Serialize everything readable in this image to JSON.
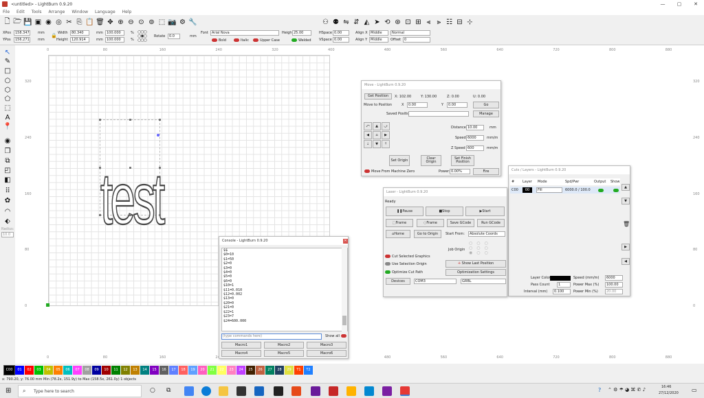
{
  "app": {
    "title": "<untitled> - LightBurn 0.9.20"
  },
  "menu": [
    "File",
    "Edit",
    "Tools",
    "Arrange",
    "Window",
    "Language",
    "Help"
  ],
  "toolbar2": {
    "xpos_label": "XPos",
    "xpos": "158.347",
    "ypos_label": "YPos",
    "ypos": "156.271",
    "unit": "mm",
    "width_label": "Width",
    "width": "80.340",
    "height_label": "Height",
    "height": "120.914",
    "scale_w": "100.000",
    "scale_h": "100.000",
    "pct": "%",
    "rotate_label": "Rotate",
    "rotate": "0.0",
    "font_label": "Font",
    "font": "Arial Nova",
    "font_height_label": "Height",
    "font_height": "25.00",
    "hspace_label": "HSpace",
    "hspace": "0.00",
    "vspace_label": "VSpace",
    "vspace": "0.00",
    "alignx_label": "Align X",
    "alignx": "Middle",
    "aligny_label": "Align Y",
    "aligny": "Middle",
    "mode": "Normal",
    "offset_label": "Offset",
    "offset": "0",
    "bold": "Bold",
    "italic": "Italic",
    "upper": "Upper Case",
    "welded": "Welded"
  },
  "ruler": {
    "top": [
      "0",
      "80",
      "160",
      "240",
      "320",
      "400",
      "480",
      "560",
      "640",
      "720",
      "800",
      "880"
    ],
    "left": [
      "320",
      "240",
      "160",
      "80",
      "0"
    ],
    "right": [
      "320",
      "240",
      "160",
      "80",
      "0"
    ]
  },
  "canvas": {
    "text": "test"
  },
  "left_tools": {
    "radius_label": "Radius:",
    "radius": "10.0"
  },
  "move": {
    "title": "Move - LightBurn 0.9.20",
    "get_position": "Get Position",
    "x": "X: 102.00",
    "y": "Y: 130.00",
    "z": "Z: 0.00",
    "u": "U: 0.00",
    "move_to": "Move to Position",
    "x_label": "X",
    "x_val": "0.00",
    "y_label": "Y",
    "y_val": "0.00",
    "go": "Go",
    "saved_label": "Saved Positions:",
    "manage": "Manage",
    "distance_label": "Distance",
    "distance": "10.00",
    "speed_label": "Speed",
    "speed": "6000",
    "zspeed_label": "Z Speed",
    "zspeed": "600",
    "unit_mm": "mm",
    "unit_mms": "mm/m",
    "set_origin": "Set Origin",
    "clear_origin": "Clear Origin",
    "set_finish": "Set Finish Position",
    "move_from_zero": "Move From Machine Zero",
    "power_label": "Power:",
    "power": "0.00%",
    "fire": "Fire"
  },
  "laser": {
    "title": "Laser - LightBurn 0.9.20",
    "state": "Ready",
    "pause": "Pause",
    "stop": "Stop",
    "start": "Start",
    "frame1": "Frame",
    "frame2": "Frame",
    "save_gcode": "Save GCode",
    "run_gcode": "Run GCode",
    "home": "Home",
    "go_origin": "Go to Origin",
    "start_from_label": "Start From:",
    "start_from": "Absolute Coords",
    "job_origin": "Job Origin",
    "cut_selected": "Cut Selected Graphics",
    "use_selection": "Use Selection Origin",
    "show_last": "Show Last Position",
    "optimize": "Optimize Cut Path",
    "opt_settings": "Optimization Settings",
    "devices": "Devices",
    "port": "COM3",
    "firmware": "GRBL"
  },
  "cuts": {
    "title": "Cuts / Layers - LightBurn 0.9.20",
    "headers": [
      "#",
      "Layer",
      "Mode",
      "Spd/Pwr",
      "Output",
      "Show"
    ],
    "row": {
      "num": "C00",
      "layer": "00",
      "mode": "Fill",
      "spdpwr": "6000.0 / 100.0"
    },
    "layer_color": "Layer Color",
    "speed_label": "Speed (mm/m)",
    "speed": "6000",
    "passes_label": "Pass Count",
    "passes": "1",
    "pmax_label": "Power Max (%)",
    "pmax": "100.00",
    "interval_label": "Interval (mm)",
    "interval": "0.100",
    "pmin_label": "Power Min (%)",
    "pmin": "20.00"
  },
  "console": {
    "title": "Console - LightBurn 0.9.20",
    "lines": [
      "$$",
      "$0=10",
      "$1=50",
      "$2=0",
      "$3=0",
      "$4=0",
      "$5=0",
      "$6=0",
      "$10=1",
      "$11=0.010",
      "$12=0.002",
      "$13=0",
      "$20=0",
      "$21=0",
      "$22=1",
      "$23=7",
      "$24=600.000"
    ],
    "placeholder": "(type commands here)",
    "show_all": "Show all",
    "macros": [
      "Macro1",
      "Macro2",
      "Macro3",
      "Macro4",
      "Macro5",
      "Macro6"
    ]
  },
  "palette": [
    {
      "label": "C00",
      "color": "#000000"
    },
    {
      "label": "01",
      "color": "#0000ff"
    },
    {
      "label": "02",
      "color": "#ff0000"
    },
    {
      "label": "03",
      "color": "#00c000"
    },
    {
      "label": "04",
      "color": "#c0c000"
    },
    {
      "label": "05",
      "color": "#ff8000"
    },
    {
      "label": "06",
      "color": "#00c0c0"
    },
    {
      "label": "07",
      "color": "#ff40ff"
    },
    {
      "label": "08",
      "color": "#a0a0a0"
    },
    {
      "label": "09",
      "color": "#0000a0"
    },
    {
      "label": "10",
      "color": "#a00000"
    },
    {
      "label": "11",
      "color": "#008000"
    },
    {
      "label": "12",
      "color": "#808000"
    },
    {
      "label": "13",
      "color": "#c08000"
    },
    {
      "label": "14",
      "color": "#008080"
    },
    {
      "label": "15",
      "color": "#8000c0"
    },
    {
      "label": "16",
      "color": "#606060"
    },
    {
      "label": "17",
      "color": "#6080ff"
    },
    {
      "label": "18",
      "color": "#ff6060"
    },
    {
      "label": "19",
      "color": "#60a0ff"
    },
    {
      "label": "20",
      "color": "#ff60c0"
    },
    {
      "label": "21",
      "color": "#80ff40"
    },
    {
      "label": "22",
      "color": "#ffff60"
    },
    {
      "label": "23",
      "color": "#ff80c0"
    },
    {
      "label": "24",
      "color": "#c040ff"
    },
    {
      "label": "25",
      "color": "#402000"
    },
    {
      "label": "26",
      "color": "#c06040"
    },
    {
      "label": "27",
      "color": "#008060"
    },
    {
      "label": "28",
      "color": "#204060"
    },
    {
      "label": "29",
      "color": "#e0e040"
    },
    {
      "label": "T1",
      "color": "#ff4000"
    },
    {
      "label": "T2",
      "color": "#2080ff"
    }
  ],
  "status": "x: 790.20, y: 76.00 mm    Min (78.2x, 151.9y) to Max (158.5x, 261.0y)  1 objects",
  "taskbar": {
    "search": "Type here to search",
    "time": "16:46",
    "date": "27/12/2020"
  }
}
